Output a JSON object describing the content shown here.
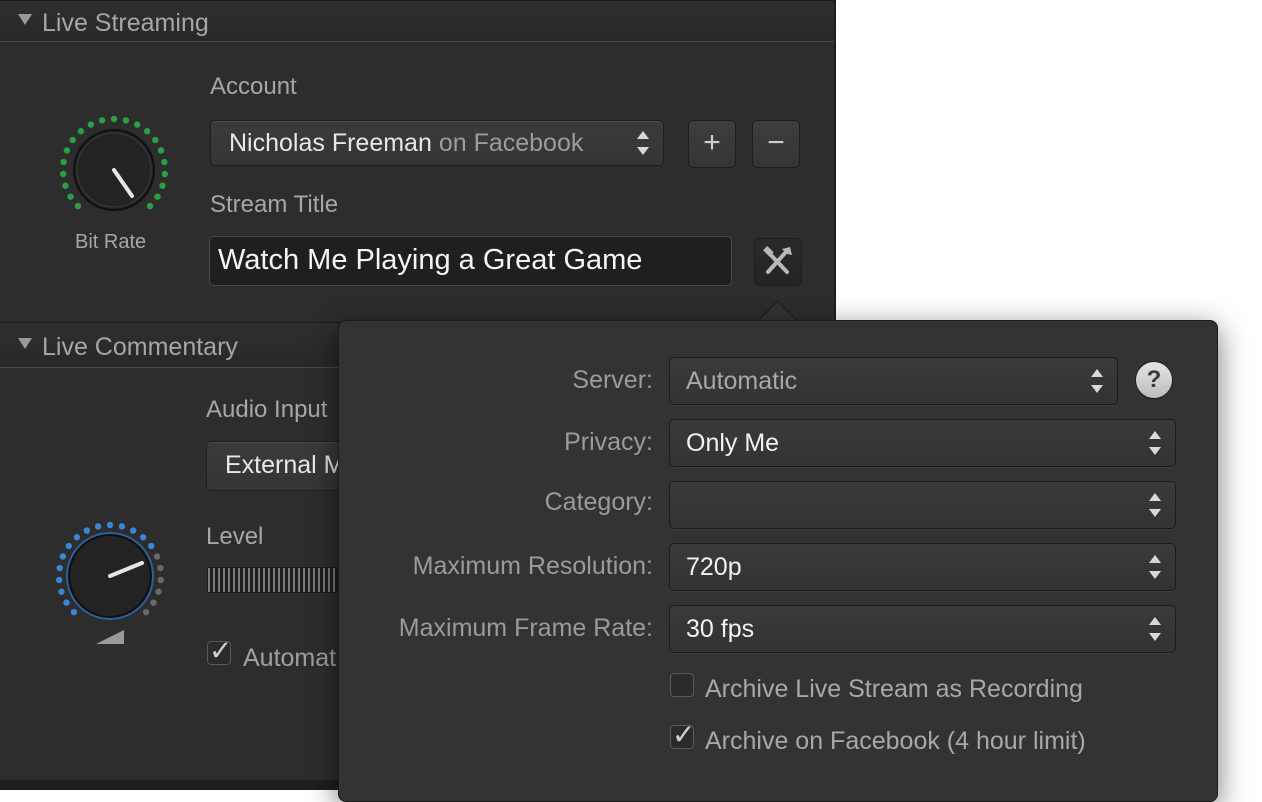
{
  "live_streaming": {
    "title": "Live Streaming",
    "account_label": "Account",
    "account_name": "Nicholas Freeman",
    "account_service": "on Facebook",
    "add_label": "+",
    "remove_label": "−",
    "stream_title_label": "Stream Title",
    "stream_title_value": "Watch Me Playing a Great Game",
    "bitrate_label": "Bit Rate"
  },
  "live_commentary": {
    "title": "Live Commentary",
    "audio_input_label": "Audio Input",
    "audio_input_value": "External M",
    "level_label": "Level",
    "auto_label": "Automat"
  },
  "popover": {
    "server_label": "Server:",
    "server_value": "Automatic",
    "help_label": "?",
    "privacy_label": "Privacy:",
    "privacy_value": "Only Me",
    "category_label": "Category:",
    "category_value": "",
    "resolution_label": "Maximum Resolution:",
    "resolution_value": "720p",
    "framerate_label": "Maximum Frame Rate:",
    "framerate_value": "30 fps",
    "archive_recording_label": "Archive Live Stream as Recording",
    "archive_recording_checked": false,
    "archive_facebook_label": "Archive on Facebook (4 hour limit)",
    "archive_facebook_checked": true
  },
  "colors": {
    "bitrate_dots": "#2e9e44",
    "level_dots": "#3a86d6",
    "panel_bg": "#2d2d2d",
    "popover_bg": "#333333"
  }
}
